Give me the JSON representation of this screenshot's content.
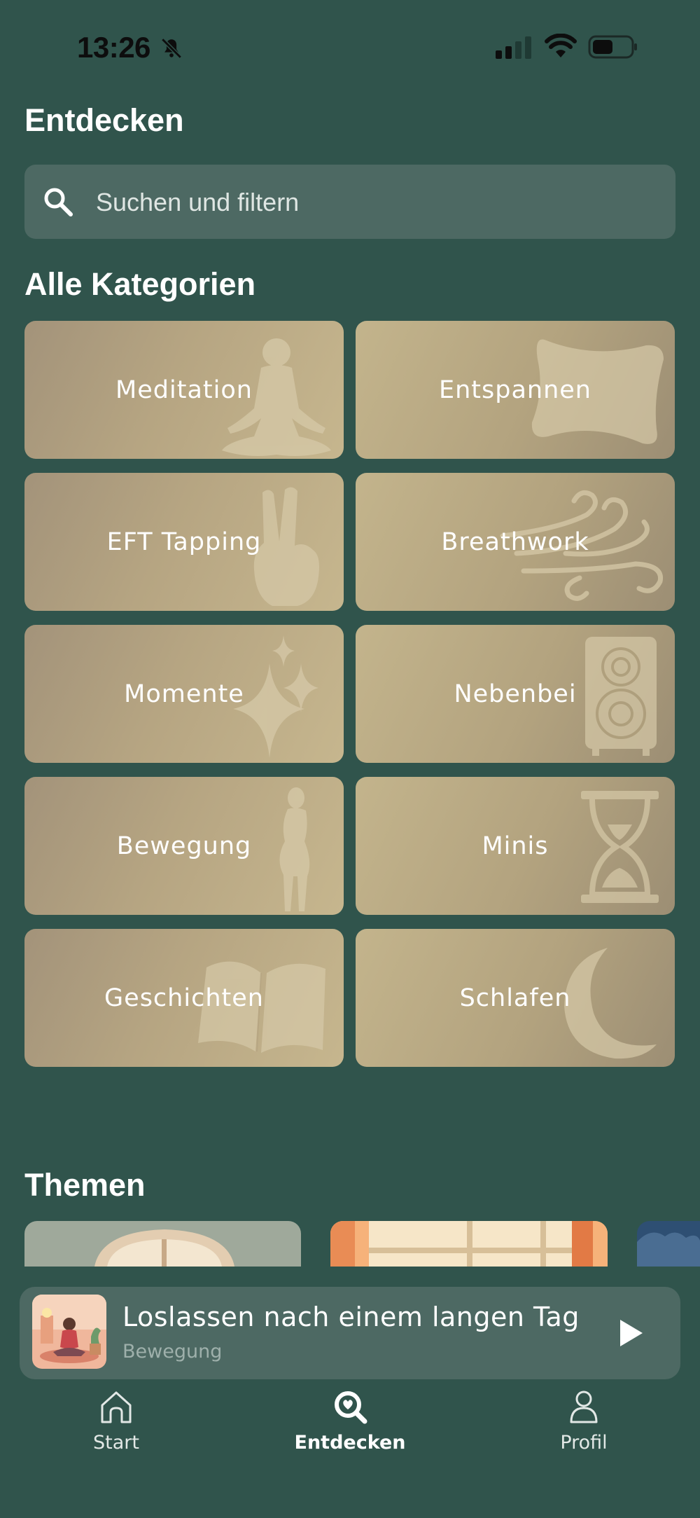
{
  "status_bar": {
    "time": "13:26",
    "icons": [
      "bell-muted-icon",
      "cellular-signal-icon",
      "wifi-icon",
      "battery-icon"
    ]
  },
  "header": {
    "title": "Entdecken"
  },
  "search": {
    "placeholder": "Suchen und filtern",
    "icon": "search-icon"
  },
  "categories": {
    "title": "Alle Kategorien",
    "items": [
      {
        "label": "Meditation",
        "icon": "meditation-figure-icon"
      },
      {
        "label": "Entspannen",
        "icon": "pillow-icon"
      },
      {
        "label": "EFT Tapping",
        "icon": "hand-icon"
      },
      {
        "label": "Breathwork",
        "icon": "wind-icon"
      },
      {
        "label": "Momente",
        "icon": "sparkles-icon"
      },
      {
        "label": "Nebenbei",
        "icon": "speaker-icon"
      },
      {
        "label": "Bewegung",
        "icon": "body-figure-icon"
      },
      {
        "label": "Minis",
        "icon": "hourglass-icon"
      },
      {
        "label": "Geschichten",
        "icon": "open-book-icon"
      },
      {
        "label": "Schlafen",
        "icon": "moon-icon"
      }
    ]
  },
  "themes": {
    "title": "Themen"
  },
  "now_playing": {
    "title": "Loslassen nach einem langen Tag",
    "category": "Bewegung",
    "play_icon": "play-icon"
  },
  "tab_bar": {
    "tabs": [
      {
        "label": "Start",
        "icon": "home-icon",
        "active": false
      },
      {
        "label": "Entdecken",
        "icon": "discover-icon",
        "active": true
      },
      {
        "label": "Profil",
        "icon": "profile-icon",
        "active": false
      }
    ]
  },
  "colors": {
    "background": "#30544c",
    "surface": "#4d6963",
    "tile_gold": "#c3b48c",
    "text": "#ffffff"
  }
}
